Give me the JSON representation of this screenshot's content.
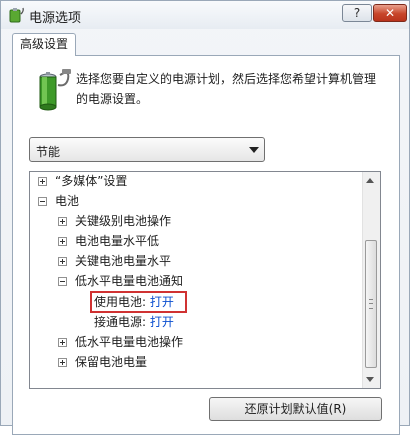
{
  "window": {
    "title": "电源选项",
    "help": "?",
    "close": "✕"
  },
  "tab": {
    "label": "高级设置"
  },
  "description": "选择您要自定义的电源计划，然后选择您希望计算机管理的电源设置。",
  "plan_select": {
    "value": "节能"
  },
  "tree": {
    "multimedia": "“多媒体”设置",
    "battery": "电池",
    "critical_action": "关键级别电池操作",
    "low_level": "电池电量水平低",
    "critical_level": "关键电池电量水平",
    "low_notification": "低水平电量电池通知",
    "on_battery_label": "使用电池:",
    "on_battery_value": "打开",
    "plugged_in_label": "接通电源:",
    "plugged_in_value": "打开",
    "low_action": "低水平电量电池操作",
    "reserve_level": "保留电池电量"
  },
  "buttons": {
    "restore": "还原计划默认值(R)"
  },
  "icons": {
    "title": "power-options-icon",
    "battery": "battery-icon"
  }
}
